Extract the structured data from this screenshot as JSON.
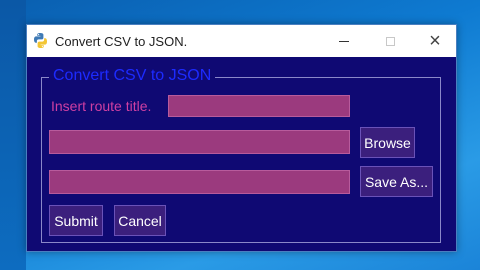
{
  "window": {
    "title": "Convert CSV to JSON.",
    "icon": "python-icon",
    "controls": {
      "minimize": "minimize-icon",
      "maximize": "maximize-icon",
      "close": "×"
    }
  },
  "form": {
    "legend": "Convert CSV to JSON",
    "route_label": "Insert route title.",
    "route_value": "",
    "source_value": "",
    "destination_value": "",
    "browse_label": "Browse",
    "save_as_label": "Save As...",
    "submit_label": "Submit",
    "cancel_label": "Cancel"
  },
  "colors": {
    "window_bg": "#0f0973",
    "legend": "#1d2bff",
    "label": "#cf3fa2",
    "input_bg": "#9b3a7e",
    "button_bg": "#3b1f7d"
  }
}
